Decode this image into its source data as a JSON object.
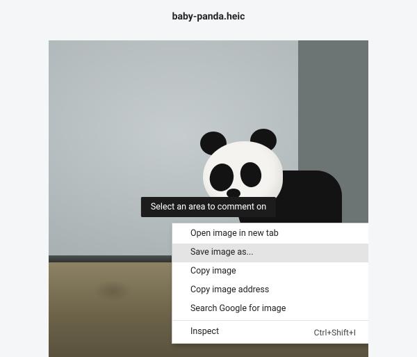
{
  "filename": "baby-panda.heic",
  "hint_banner": "Select an area to comment on",
  "context_menu": {
    "items": [
      {
        "label": "Open image in new tab",
        "shortcut": ""
      },
      {
        "label": "Save image as...",
        "shortcut": ""
      },
      {
        "label": "Copy image",
        "shortcut": ""
      },
      {
        "label": "Copy image address",
        "shortcut": ""
      },
      {
        "label": "Search Google for image",
        "shortcut": ""
      }
    ],
    "inspect": {
      "label": "Inspect",
      "shortcut": "Ctrl+Shift+I"
    },
    "highlighted_index": 1
  }
}
